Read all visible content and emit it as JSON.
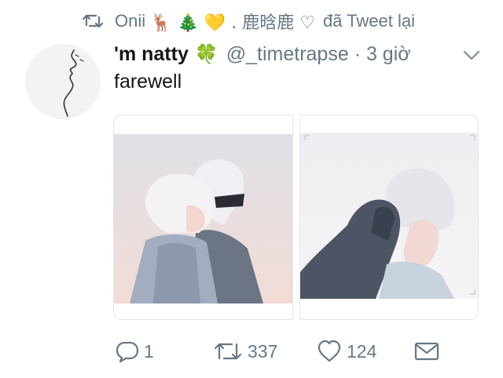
{
  "retweet": {
    "user_name": "Onii",
    "emojis": "🦌 🎄 💛 . 鹿晗鹿 ♡",
    "suffix": "đã Tweet lại"
  },
  "tweet": {
    "display_name": "'m natty",
    "name_emoji": "🍀",
    "handle_time": "@_timetrapse · 3 giờ",
    "text": "farewell"
  },
  "actions": {
    "reply_count": "1",
    "retweet_count": "337",
    "like_count": "124"
  },
  "icons": {
    "retweet": "retweet-icon",
    "chevron": "chevron-down-icon",
    "reply": "reply-icon",
    "like": "heart-icon",
    "dm": "envelope-icon"
  },
  "colors": {
    "muted": "#657786",
    "text": "#14171a"
  }
}
